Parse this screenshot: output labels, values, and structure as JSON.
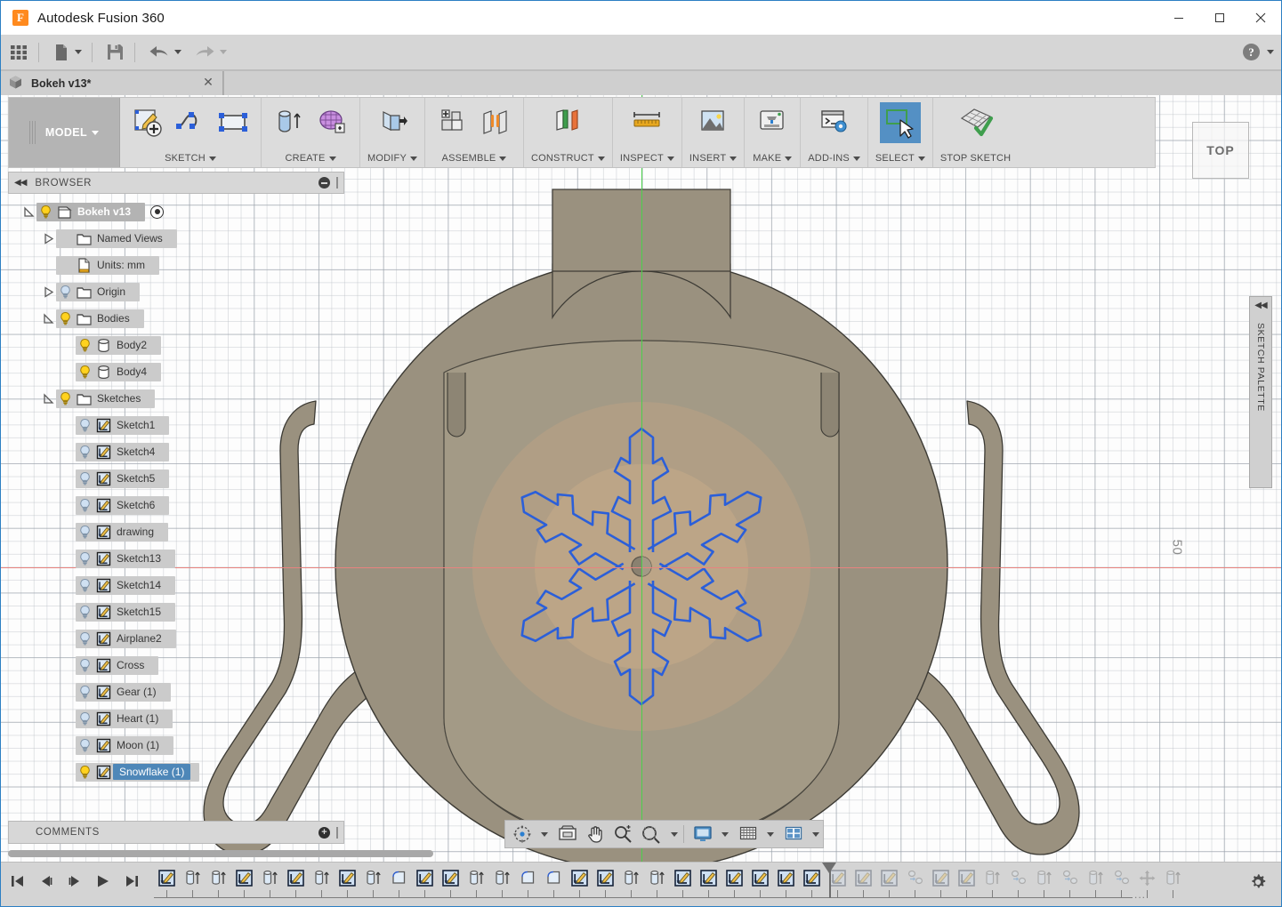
{
  "window": {
    "title": "Autodesk Fusion 360",
    "logo_icon": "fusion-logo-icon",
    "minimize_icon": "minimize-icon",
    "maximize_icon": "maximize-icon",
    "close_icon": "close-icon"
  },
  "quick_access": {
    "items": [
      {
        "name": "show-data-panel",
        "icon": "grid-squares-icon",
        "has_caret": false
      },
      {
        "name": "file-menu",
        "icon": "file-page-icon",
        "has_caret": true
      },
      {
        "name": "save-button",
        "icon": "floppy-disk-icon",
        "has_caret": false
      },
      {
        "name": "undo-button",
        "icon": "undo-arrow-icon",
        "has_caret": true
      },
      {
        "name": "redo-button",
        "icon": "redo-arrow-icon",
        "has_caret": true
      }
    ],
    "help": {
      "icon": "help-question-icon",
      "has_caret": true
    }
  },
  "document_tab": {
    "icon": "cube-icon",
    "label": "Bokeh v13*",
    "close_icon": "close-icon"
  },
  "ribbon": {
    "workspace": {
      "label": "MODEL",
      "has_caret": true
    },
    "groups": [
      {
        "label": "SKETCH",
        "has_caret": true,
        "buttons": [
          {
            "name": "create-sketch-button",
            "icon": "new-sketch-icon"
          },
          {
            "name": "spline-button",
            "icon": "spline-curve-icon"
          },
          {
            "name": "rectangle-button",
            "icon": "rectangle-icon"
          }
        ]
      },
      {
        "label": "CREATE",
        "has_caret": true,
        "buttons": [
          {
            "name": "extrude-button",
            "icon": "extrude-icon"
          },
          {
            "name": "create-form-button",
            "icon": "tspline-form-icon"
          }
        ]
      },
      {
        "label": "MODIFY",
        "has_caret": true,
        "buttons": [
          {
            "name": "press-pull-button",
            "icon": "press-pull-icon"
          }
        ]
      },
      {
        "label": "ASSEMBLE",
        "has_caret": true,
        "buttons": [
          {
            "name": "new-component-button",
            "icon": "new-component-icon"
          },
          {
            "name": "joint-button",
            "icon": "joint-icon"
          }
        ]
      },
      {
        "label": "CONSTRUCT",
        "has_caret": true,
        "buttons": [
          {
            "name": "offset-plane-button",
            "icon": "construction-plane-icon"
          }
        ]
      },
      {
        "label": "INSPECT",
        "has_caret": true,
        "buttons": [
          {
            "name": "measure-button",
            "icon": "ruler-measure-icon"
          }
        ]
      },
      {
        "label": "INSERT",
        "has_caret": true,
        "buttons": [
          {
            "name": "insert-canvas-button",
            "icon": "image-canvas-icon"
          }
        ]
      },
      {
        "label": "MAKE",
        "has_caret": true,
        "buttons": [
          {
            "name": "3d-print-button",
            "icon": "3d-printer-icon"
          }
        ]
      },
      {
        "label": "ADD-INS",
        "has_caret": true,
        "buttons": [
          {
            "name": "scripts-addins-button",
            "icon": "console-gear-icon"
          }
        ]
      },
      {
        "label": "SELECT",
        "has_caret": true,
        "active": true,
        "buttons": [
          {
            "name": "select-tool-button",
            "icon": "select-cursor-icon"
          }
        ]
      },
      {
        "label": "STOP SKETCH",
        "has_caret": false,
        "buttons": [
          {
            "name": "stop-sketch-button",
            "icon": "stop-sketch-icon"
          }
        ]
      }
    ]
  },
  "browser": {
    "title": "BROWSER",
    "collapse_icon": "collapse-left-icon",
    "options_icon": "panel-options-icon",
    "tree": [
      {
        "label": "Bokeh v13",
        "indent": 0,
        "arrow": "expanded",
        "bulb": "on",
        "icon": "component-cube-icon",
        "root": true,
        "radio": true
      },
      {
        "label": "Named Views",
        "indent": 1,
        "arrow": "collapsed",
        "bulb": "none",
        "icon": "folder-icon"
      },
      {
        "label": "Units: mm",
        "indent": 1,
        "arrow": "none",
        "bulb": "none",
        "icon": "units-doc-icon"
      },
      {
        "label": "Origin",
        "indent": 1,
        "arrow": "collapsed",
        "bulb": "off",
        "icon": "folder-icon"
      },
      {
        "label": "Bodies",
        "indent": 1,
        "arrow": "expanded",
        "bulb": "on",
        "icon": "folder-icon"
      },
      {
        "label": "Body2",
        "indent": 2,
        "arrow": "none",
        "bulb": "on",
        "icon": "body-icon"
      },
      {
        "label": "Body4",
        "indent": 2,
        "arrow": "none",
        "bulb": "on",
        "icon": "body-icon"
      },
      {
        "label": "Sketches",
        "indent": 1,
        "arrow": "expanded",
        "bulb": "on",
        "icon": "folder-icon"
      },
      {
        "label": "Sketch1",
        "indent": 2,
        "arrow": "none",
        "bulb": "off",
        "icon": "sketch-icon"
      },
      {
        "label": "Sketch4",
        "indent": 2,
        "arrow": "none",
        "bulb": "off",
        "icon": "sketch-icon"
      },
      {
        "label": "Sketch5",
        "indent": 2,
        "arrow": "none",
        "bulb": "off",
        "icon": "sketch-icon"
      },
      {
        "label": "Sketch6",
        "indent": 2,
        "arrow": "none",
        "bulb": "off",
        "icon": "sketch-icon"
      },
      {
        "label": "drawing",
        "indent": 2,
        "arrow": "none",
        "bulb": "off",
        "icon": "sketch-icon"
      },
      {
        "label": "Sketch13",
        "indent": 2,
        "arrow": "none",
        "bulb": "off",
        "icon": "sketch-icon"
      },
      {
        "label": "Sketch14",
        "indent": 2,
        "arrow": "none",
        "bulb": "off",
        "icon": "sketch-icon"
      },
      {
        "label": "Sketch15",
        "indent": 2,
        "arrow": "none",
        "bulb": "off",
        "icon": "sketch-icon"
      },
      {
        "label": "Airplane2",
        "indent": 2,
        "arrow": "none",
        "bulb": "off",
        "icon": "sketch-icon"
      },
      {
        "label": "Cross",
        "indent": 2,
        "arrow": "none",
        "bulb": "off",
        "icon": "sketch-icon"
      },
      {
        "label": "Gear (1)",
        "indent": 2,
        "arrow": "none",
        "bulb": "off",
        "icon": "sketch-icon"
      },
      {
        "label": "Heart (1)",
        "indent": 2,
        "arrow": "none",
        "bulb": "off",
        "icon": "sketch-icon"
      },
      {
        "label": "Moon (1)",
        "indent": 2,
        "arrow": "none",
        "bulb": "off",
        "icon": "sketch-icon"
      },
      {
        "label": "Snowflake (1)",
        "indent": 2,
        "arrow": "none",
        "bulb": "on",
        "icon": "sketch-icon",
        "selected": true
      }
    ]
  },
  "comments": {
    "title": "COMMENTS",
    "add_icon": "add-comment-icon"
  },
  "canvas": {
    "view_cube_label": "TOP",
    "dimension_label": "50",
    "axis_x_color": "#e8837f",
    "axis_y_color": "#4bd04b",
    "sketch_line_color": "#2b5fd9",
    "body_fill_color": "#9a917f",
    "sketch_profile_fill": "#c7ab88",
    "sketch_palette": {
      "title": "SKETCH PALETTE",
      "collapse_icon": "collapse-right-icon"
    }
  },
  "navigation_bar": {
    "items": [
      {
        "name": "orbit-button",
        "icon": "orbit-icon",
        "has_caret": true
      },
      {
        "name": "look-at-button",
        "icon": "look-at-icon",
        "has_caret": false
      },
      {
        "name": "pan-button",
        "icon": "hand-pan-icon",
        "has_caret": false
      },
      {
        "name": "zoom-button",
        "icon": "magnifier-plusminus-icon",
        "has_caret": false
      },
      {
        "name": "fit-button",
        "icon": "zoom-fit-icon",
        "has_caret": true
      }
    ],
    "display_items": [
      {
        "name": "display-settings-button",
        "icon": "monitor-display-icon",
        "has_caret": true
      },
      {
        "name": "grid-snaps-button",
        "icon": "grid-snap-icon",
        "has_caret": true
      },
      {
        "name": "viewports-button",
        "icon": "viewport-layout-icon",
        "has_caret": true
      }
    ]
  },
  "timeline": {
    "playback": [
      {
        "name": "timeline-begin-button",
        "icon": "skip-to-start-icon"
      },
      {
        "name": "timeline-step-back-button",
        "icon": "step-back-icon"
      },
      {
        "name": "timeline-step-forward-button",
        "icon": "step-forward-icon"
      },
      {
        "name": "timeline-play-button",
        "icon": "play-icon"
      },
      {
        "name": "timeline-end-button",
        "icon": "skip-to-end-icon"
      }
    ],
    "features": [
      {
        "icon": "sketch-icon",
        "dim": false
      },
      {
        "icon": "extrude-icon",
        "dim": false
      },
      {
        "icon": "extrude-icon",
        "dim": false
      },
      {
        "icon": "sketch-icon",
        "dim": false
      },
      {
        "icon": "extrude-icon",
        "dim": false
      },
      {
        "icon": "sketch-icon",
        "dim": false
      },
      {
        "icon": "extrude-icon",
        "dim": false
      },
      {
        "icon": "sketch-icon",
        "dim": false
      },
      {
        "icon": "extrude-icon",
        "dim": false
      },
      {
        "icon": "fillet-icon",
        "dim": false
      },
      {
        "icon": "sketch-icon",
        "dim": false
      },
      {
        "icon": "sketch-icon",
        "dim": false
      },
      {
        "icon": "extrude-icon",
        "dim": false
      },
      {
        "icon": "extrude-icon",
        "dim": false
      },
      {
        "icon": "fillet-icon",
        "dim": false
      },
      {
        "icon": "fillet-icon",
        "dim": false
      },
      {
        "icon": "sketch-icon",
        "dim": false
      },
      {
        "icon": "sketch-icon",
        "dim": false
      },
      {
        "icon": "extrude-icon",
        "dim": false
      },
      {
        "icon": "extrude-icon",
        "dim": false
      },
      {
        "icon": "sketch-icon",
        "dim": false
      },
      {
        "icon": "sketch-icon",
        "dim": false
      },
      {
        "icon": "sketch-icon",
        "dim": false
      },
      {
        "icon": "sketch-icon",
        "dim": false
      },
      {
        "icon": "sketch-icon",
        "dim": false
      },
      {
        "icon": "sketch-icon",
        "dim": false
      },
      {
        "icon": "sketch-icon",
        "dim": true
      },
      {
        "icon": "sketch-icon",
        "dim": true
      },
      {
        "icon": "sketch-icon",
        "dim": true
      },
      {
        "icon": "pattern-icon",
        "dim": true
      },
      {
        "icon": "sketch-icon",
        "dim": true
      },
      {
        "icon": "sketch-icon",
        "dim": true
      },
      {
        "icon": "extrude-icon",
        "dim": true
      },
      {
        "icon": "pattern-icon",
        "dim": true
      },
      {
        "icon": "extrude-icon",
        "dim": true
      },
      {
        "icon": "pattern-icon",
        "dim": true
      },
      {
        "icon": "extrude-icon",
        "dim": true
      },
      {
        "icon": "pattern-icon",
        "dim": true
      },
      {
        "icon": "move-icon",
        "dim": true
      },
      {
        "icon": "extrude-icon",
        "dim": true
      }
    ],
    "marker_index": 26,
    "overflow_dots": "...",
    "settings_icon": "gear-icon"
  }
}
